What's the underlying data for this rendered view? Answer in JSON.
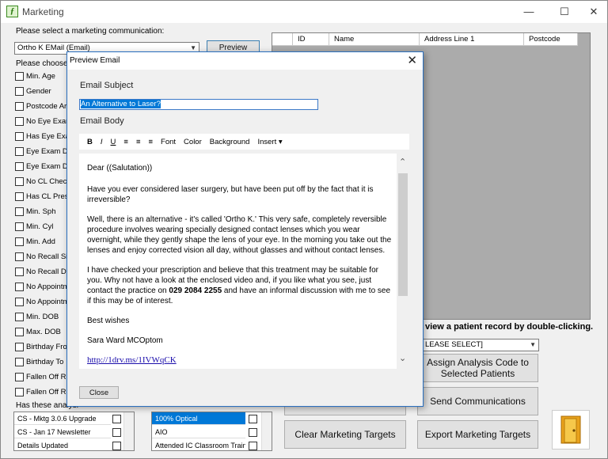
{
  "window": {
    "title": "Marketing",
    "minimize": "—",
    "maximize": "☐",
    "close": "✕"
  },
  "left": {
    "select_label": "Please select a marketing communication:",
    "comm_value": "Ortho K EMail (Email)",
    "preview_button": "Preview",
    "choose_label": "Please choose yo",
    "criteria": [
      "Min. Age",
      "Gender",
      "Postcode Area",
      "No Eye Exam",
      "Has Eye Exam",
      "Eye Exam Due",
      "Eye Exam Due",
      "No CL Checku",
      "Has CL Prescr",
      "Min. Sph",
      "Min. Cyl",
      "Min. Add",
      "No Recall Sin",
      "No Recall Due",
      "No Appointme",
      "No Appointme",
      "Min. DOB",
      "Max. DOB",
      "Birthday From",
      "Birthday To",
      "Fallen Off Rec",
      "Fallen Off Rec"
    ],
    "analysis_label": "Has these analysi"
  },
  "grid": {
    "columns": [
      "",
      "ID",
      "Name",
      "Address Line 1",
      "Postcode"
    ]
  },
  "right": {
    "note": "view a patient record by double-clicking.",
    "select_placeholder": "LEASE SELECT]",
    "assign_button": "Assign Analysis Code to Selected Patients",
    "send_button": "Send Communications",
    "clear_button": "Clear Marketing Targets",
    "export_button": "Export Marketing Targets"
  },
  "lists": {
    "list1": [
      "CS - Mktg 3.0.6 Upgrade",
      "CS - Jan 17 Newsletter",
      "Details Updated"
    ],
    "list2": [
      "100% Optical",
      "AIO",
      "Attended IC Classroom Traini..."
    ]
  },
  "dialog": {
    "title": "Preview Email",
    "close": "✕",
    "subject_label": "Email Subject",
    "subject_value": "An Alternative to Laser?",
    "body_label": "Email Body",
    "toolbar": [
      "B",
      "I",
      "U",
      "≡",
      "≡",
      "≡",
      "Font",
      "Color",
      "Background",
      "Insert ▾"
    ],
    "body": {
      "salutation": "Dear ((Salutation))",
      "p1": "Have you ever considered laser surgery, but have been put off by the fact that it is irreversible?",
      "p2": "Well, there is an alternative - it's called 'Ortho K.' This very safe, completely reversible procedure involves wearing specially designed contact lenses which you wear overnight, while they gently shape the lens of your eye. In the morning you take out the lenses and enjoy corrected vision all day, without glasses and without contact lenses.",
      "p3_pre": "I have checked your prescription and believe that this treatment may be suitable for you. Why not have a look at the enclosed video and, if you like what you see, just contact the practice on ",
      "phone": "029 2084 2255",
      "p3_post": " and have an informal discussion with me to see if this may be of interest.",
      "closing": "Best wishes",
      "signature": "Sara Ward MCOptom",
      "link": "http://1drv.ms/1IVWqCK"
    },
    "close_button": "Close"
  }
}
